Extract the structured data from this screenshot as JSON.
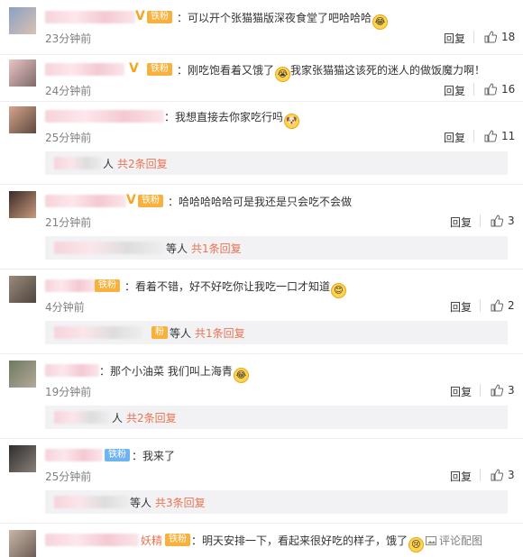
{
  "comments": [
    {
      "text": "：可以开个张猫猫版深夜食堂了吧哈哈哈",
      "time": "23分钟前",
      "reply": "回复",
      "likes": "18",
      "badge": "铁粉"
    },
    {
      "text": "：刚吃饱看着又饿了",
      "text2": "我家张猫猫这该死的迷人的做饭魔力啊！",
      "time": "24分钟前",
      "reply": "回复",
      "likes": "16",
      "badge": "铁粉"
    },
    {
      "text": "：我想直接去你家吃行吗",
      "time": "25分钟前",
      "reply": "回复",
      "likes": "11",
      "sub": {
        "who": "人",
        "count": "共2条回复"
      }
    },
    {
      "text": "：哈哈哈哈哈可是我还是只会吃不会做",
      "time": "21分钟前",
      "reply": "回复",
      "likes": "3",
      "badge": "铁粉",
      "sub": {
        "who": "等人",
        "count": "共1条回复"
      }
    },
    {
      "text": "：看着不错，好不好吃你让我吃一口才知道",
      "time": "4分钟前",
      "reply": "回复",
      "likes": "2",
      "badge": "铁粉",
      "sub": {
        "who": "等人",
        "count": "共1条回复"
      }
    },
    {
      "text": "：那个小油菜   我们叫上海青",
      "time": "19分钟前",
      "reply": "回复",
      "likes": "3",
      "sub": {
        "who": "人",
        "count": "共2条回复"
      }
    },
    {
      "text": "：我来了",
      "time": "25分钟前",
      "reply": "回复",
      "likes": "3",
      "badge": "铁粉",
      "sub": {
        "who": "等人",
        "count": "共3条回复"
      }
    },
    {
      "name_tail": "妖精",
      "text": "：明天安排一下，看起来很好吃的样子，饿了",
      "action": "评论配图",
      "badge": "铁粉"
    }
  ]
}
